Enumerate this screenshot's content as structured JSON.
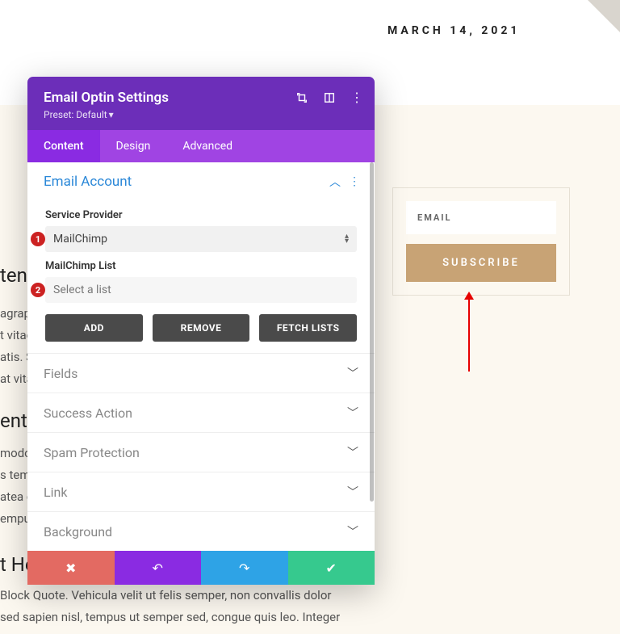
{
  "page": {
    "date": "MARCH 14, 2021"
  },
  "panel": {
    "title": "Email Optin Settings",
    "preset_prefix": "Preset: ",
    "preset_name": "Default",
    "tabs": {
      "content": "Content",
      "design": "Design",
      "advanced": "Advanced"
    },
    "email_account": {
      "title": "Email Account",
      "provider_label": "Service Provider",
      "provider_value": "MailChimp",
      "list_label": "MailChimp List",
      "list_value": "Select a list",
      "buttons": {
        "add": "ADD",
        "remove": "REMOVE",
        "fetch": "FETCH LISTS"
      }
    },
    "collapsed": {
      "fields": "Fields",
      "success": "Success Action",
      "spam": "Spam Protection",
      "link": "Link",
      "background": "Background"
    }
  },
  "subscribe": {
    "placeholder": "EMAIL",
    "button": "SUBSCRIBE"
  },
  "background_text": {
    "h1": "ten",
    "p1": "agrap\nt vitae\natis. S\nat vita",
    "h2": "ent H",
    "p2": "modo\ns temp\natea d\nempu",
    "h3": "t Hea",
    "p3": "Block Quote. Vehicula velit ut felis semper, non convallis dolor\nsed sapien nisl, tempus ut semper sed, congue quis leo. Integer"
  },
  "annotations": {
    "badge1": "1",
    "badge2": "2"
  }
}
